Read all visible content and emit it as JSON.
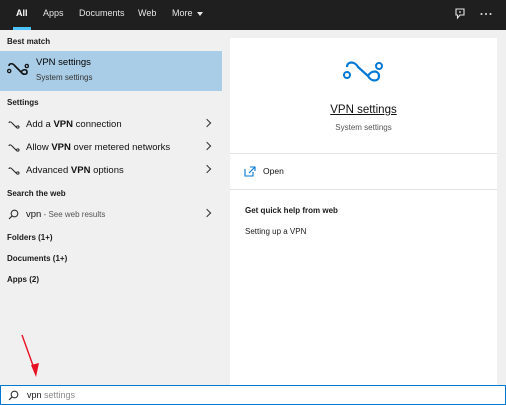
{
  "tabs": [
    "All",
    "Apps",
    "Documents",
    "Web",
    "More"
  ],
  "best_match": {
    "heading": "Best match",
    "title": "VPN settings",
    "subtitle": "System settings"
  },
  "settings": {
    "heading": "Settings",
    "items": [
      {
        "pre": "Add a ",
        "bold": "VPN",
        "post": " connection"
      },
      {
        "pre": "Allow ",
        "bold": "VPN",
        "post": " over metered networks"
      },
      {
        "pre": "Advanced ",
        "bold": "VPN",
        "post": " options"
      }
    ]
  },
  "web": {
    "heading": "Search the web",
    "query": "vpn",
    "suffix": " - See web results"
  },
  "categories": [
    "Folders (1+)",
    "Documents (1+)",
    "Apps (2)"
  ],
  "preview": {
    "title": "VPN settings",
    "subtitle": "System settings",
    "open_label": "Open",
    "help_heading": "Get quick help from web",
    "help_link": "Setting up a VPN"
  },
  "search": {
    "typed": "vpn",
    "suggestion": " settings"
  },
  "colors": {
    "accent": "#0078d4",
    "tab_underline": "#4cc2ff",
    "selection": "#a9cde6",
    "annotation": "#e81123"
  },
  "icons": {
    "vpn": "vpn-icon",
    "search": "search-icon",
    "open": "open-icon",
    "chevron": "chevron-right-icon",
    "feedback": "feedback-icon",
    "more": "more-options-icon"
  }
}
